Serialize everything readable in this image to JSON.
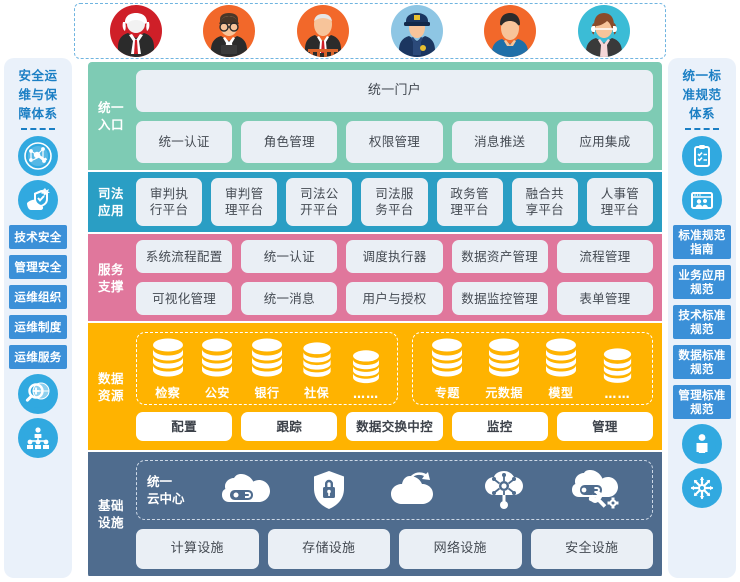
{
  "avatars": [
    {
      "name": "judge-avatar",
      "bg": "#cf1f28"
    },
    {
      "name": "lawyer-avatar",
      "bg": "#f2682a"
    },
    {
      "name": "prosecutor-avatar",
      "bg": "#f2682a"
    },
    {
      "name": "police-avatar",
      "bg": "#8ec6e4"
    },
    {
      "name": "citizen-avatar",
      "bg": "#f2682a"
    },
    {
      "name": "service-agent-avatar",
      "bg": "#3bbcd6"
    }
  ],
  "left_sidebar": {
    "title": "安全运维与保障体系",
    "title_lines": [
      "安全运",
      "维与保",
      "障体系"
    ],
    "icons_top": [
      "network-key-icon",
      "hand-shield-icon"
    ],
    "chips": [
      "技术安全",
      "管理安全",
      "运维组织",
      "运维制度",
      "运维服务"
    ],
    "icons_bottom": [
      "magnifier-globe-icon",
      "org-chart-people-icon"
    ]
  },
  "right_sidebar": {
    "title": "统一标准规范体系",
    "title_lines": [
      "统一标",
      "准规范",
      "体系"
    ],
    "icons_top": [
      "clipboard-checklist-icon",
      "window-people-icon"
    ],
    "chips": [
      {
        "lines": [
          "标准规范",
          "指南"
        ]
      },
      {
        "lines": [
          "业务应用",
          "规范"
        ]
      },
      {
        "lines": [
          "技术标准",
          "规范"
        ]
      },
      {
        "lines": [
          "数据标准",
          "规范"
        ]
      },
      {
        "lines": [
          "管理标准",
          "规范"
        ]
      }
    ],
    "icons_bottom": [
      "person-icon",
      "snowflake-node-icon"
    ]
  },
  "layers": {
    "entry": {
      "label_lines": [
        "统一",
        "入口"
      ],
      "color": "#7ecbb4",
      "portal": "统一门户",
      "items": [
        "统一认证",
        "角色管理",
        "权限管理",
        "消息推送",
        "应用集成"
      ]
    },
    "application": {
      "label_lines": [
        "司法",
        "应用"
      ],
      "color": "#2a9ec4",
      "items": [
        {
          "lines": [
            "审判执",
            "行平台"
          ]
        },
        {
          "lines": [
            "审判管",
            "理平台"
          ]
        },
        {
          "lines": [
            "司法公",
            "开平台"
          ]
        },
        {
          "lines": [
            "司法服",
            "务平台"
          ]
        },
        {
          "lines": [
            "政务管",
            "理平台"
          ]
        },
        {
          "lines": [
            "融合共",
            "享平台"
          ]
        },
        {
          "lines": [
            "人事管",
            "理平台"
          ]
        }
      ]
    },
    "service": {
      "label_lines": [
        "服务",
        "支撑"
      ],
      "color": "#e0779c",
      "row1": [
        "系统流程配置",
        "统一认证",
        "调度执行器",
        "数据资产管理",
        "流程管理"
      ],
      "row2": [
        "可视化管理",
        "统一消息",
        "用户与授权",
        "数据监控管理",
        "表单管理"
      ]
    },
    "data": {
      "label_lines": [
        "数据",
        "资源"
      ],
      "color": "#ffb300",
      "group1": [
        "检察",
        "公安",
        "银行",
        "社保",
        "……"
      ],
      "group2": [
        "专题",
        "元数据",
        "模型",
        "……"
      ],
      "bottom": [
        "配置",
        "跟踪",
        "数据交换中控",
        "监控",
        "管理"
      ]
    },
    "infrastructure": {
      "label_lines": [
        "基础",
        "设施"
      ],
      "color": "#4f6c8e",
      "cloud_title_lines": [
        "统一",
        "云中心"
      ],
      "cloud_icons": [
        "cloud-link-icon",
        "shield-lock-icon",
        "cloud-arrow-icon",
        "cloud-network-icon",
        "cloud-wrench-icon"
      ],
      "bottom": [
        "计算设施",
        "存储设施",
        "网络设施",
        "安全设施"
      ]
    }
  }
}
